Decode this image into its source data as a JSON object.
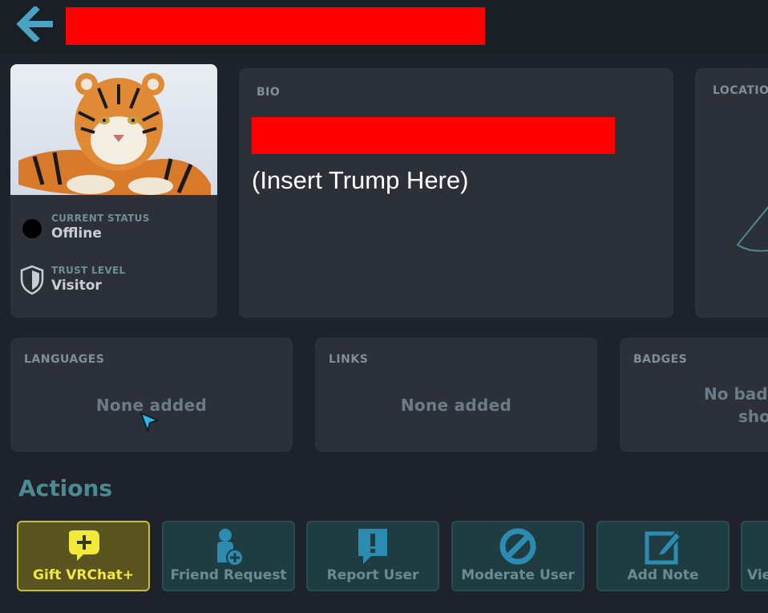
{
  "header": {
    "back_icon": "back-arrow-icon",
    "title_redacted": true
  },
  "profile": {
    "current_status_label": "CURRENT STATUS",
    "current_status_value": "Offline",
    "trust_level_label": "TRUST LEVEL",
    "trust_level_value": "Visitor"
  },
  "bio": {
    "label": "BIO",
    "text": "(Insert Trump Here)"
  },
  "location": {
    "label": "LOCATIO"
  },
  "languages": {
    "label": "LANGUAGES",
    "value": "None added"
  },
  "links": {
    "label": "LINKS",
    "value": "None added"
  },
  "badges": {
    "label": "BADGES",
    "value_line1": "No badg",
    "value_line2": "sho"
  },
  "actions": {
    "title": "Actions",
    "buttons": [
      {
        "label": "Gift VRChat+",
        "icon": "gift-speech-bubble-icon"
      },
      {
        "label": "Friend Request",
        "icon": "add-friend-icon"
      },
      {
        "label": "Report User",
        "icon": "report-icon"
      },
      {
        "label": "Moderate User",
        "icon": "block-icon"
      },
      {
        "label": "Add Note",
        "icon": "edit-note-icon"
      },
      {
        "label": "Vie",
        "icon": ""
      }
    ]
  },
  "colors": {
    "accent": "#4aa3c4",
    "gift_accent": "#f2ea3a",
    "redaction": "#ff0000"
  }
}
